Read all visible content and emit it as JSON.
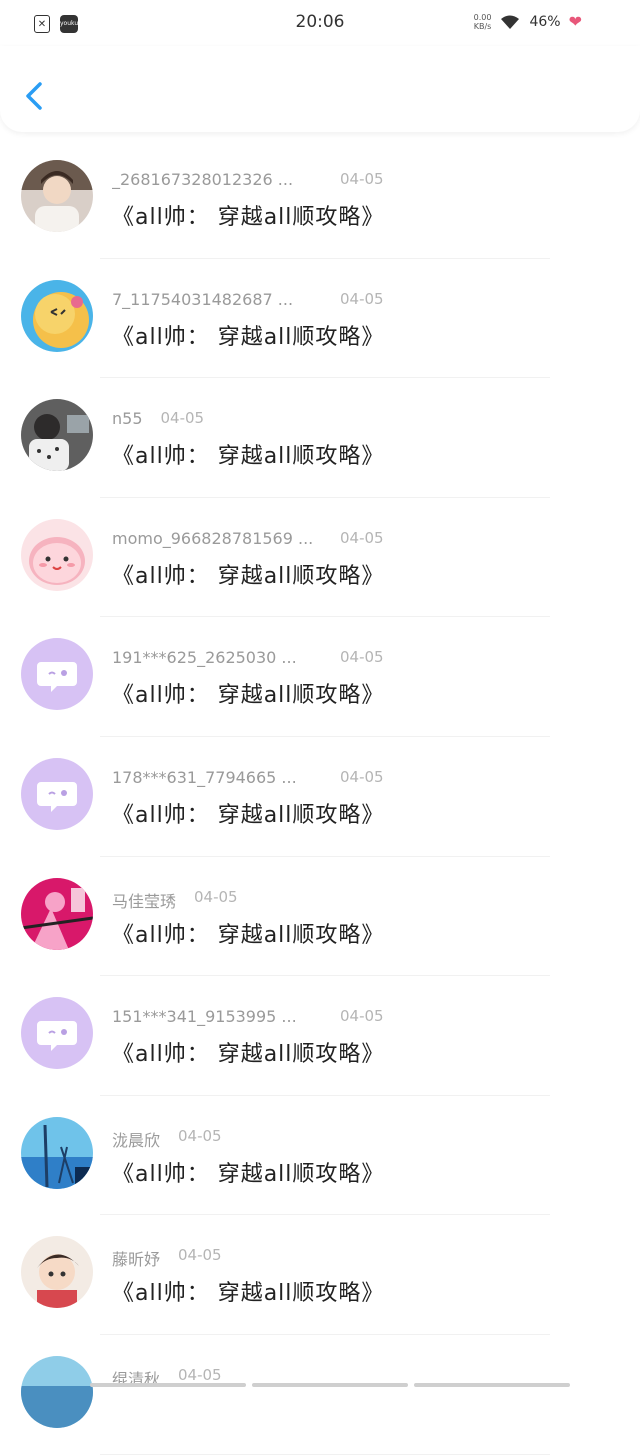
{
  "status_bar": {
    "time": "20:06",
    "net_speed_value": "0.00",
    "net_speed_unit": "KB/s",
    "battery": "46%",
    "youku_label": "youku"
  },
  "nav": {
    "back_icon": "chevron-left-icon",
    "accent_color": "#2a9df4"
  },
  "messages": [
    {
      "username": "_268167328012326 ...",
      "date": "04-05",
      "text": "《all帅： 穿越all顺攻略》",
      "avatar": "photo-boy"
    },
    {
      "username": "7_11754031482687 ...",
      "date": "04-05",
      "text": "《all帅： 穿越all顺攻略》",
      "avatar": "cartoon-ball"
    },
    {
      "username": "n55",
      "date": "04-05",
      "text": "《all帅： 穿越all顺攻略》",
      "avatar": "photo-room"
    },
    {
      "username": "momo_966828781569 ...",
      "date": "04-05",
      "text": "《all帅： 穿越all顺攻略》",
      "avatar": "pink-blob"
    },
    {
      "username": "191***625_2625030 ...",
      "date": "04-05",
      "text": "《all帅： 穿越all顺攻略》",
      "avatar": "default-chat"
    },
    {
      "username": "178***631_7794665 ...",
      "date": "04-05",
      "text": "《all帅： 穿越all顺攻略》",
      "avatar": "default-chat"
    },
    {
      "username": "马佳莹琇",
      "date": "04-05",
      "text": "《all帅： 穿越all顺攻略》",
      "avatar": "pink-panther"
    },
    {
      "username": "151***341_9153995 ...",
      "date": "04-05",
      "text": "《all帅： 穿越all顺攻略》",
      "avatar": "default-chat"
    },
    {
      "username": "泷晨欣",
      "date": "04-05",
      "text": "《all帅： 穿越all顺攻略》",
      "avatar": "blue-photo"
    },
    {
      "username": "藤昕妤",
      "date": "04-05",
      "text": "《all帅： 穿越all顺攻略》",
      "avatar": "anime-boy"
    },
    {
      "username": "绲清秋",
      "date": "04-05",
      "text": "",
      "avatar": "blue-photo-2"
    }
  ]
}
